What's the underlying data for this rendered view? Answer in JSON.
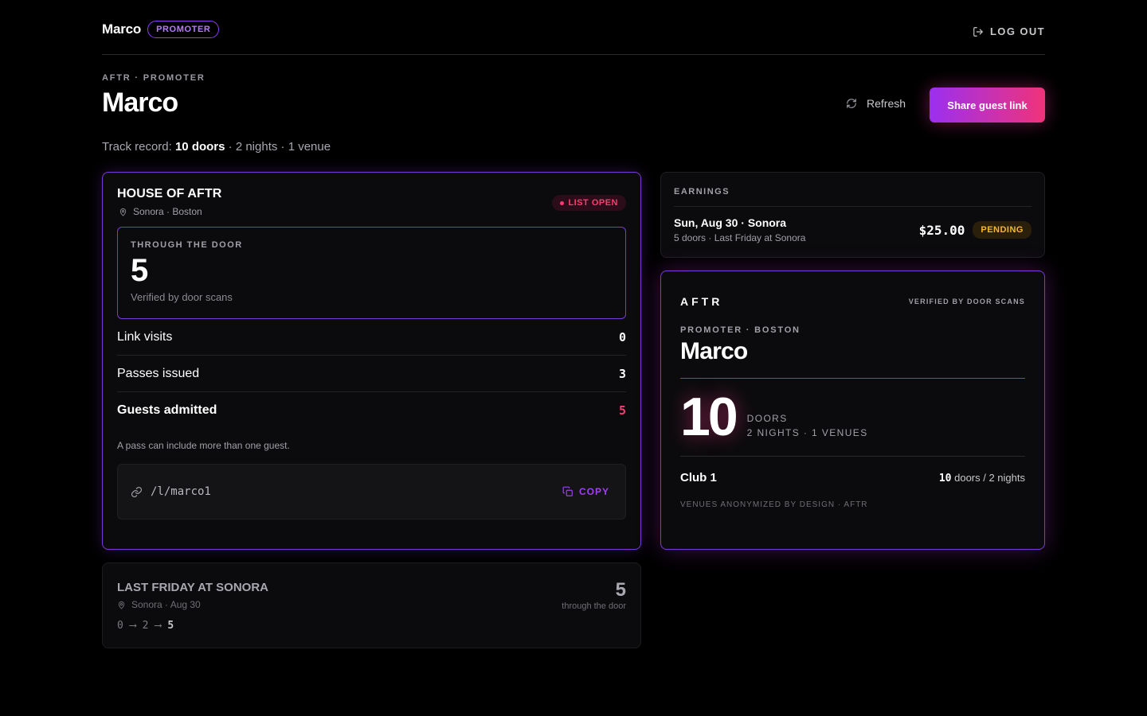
{
  "nav": {
    "user_name": "Marco",
    "role_badge": "PROMOTER",
    "logout_label": "LOG OUT"
  },
  "header": {
    "eyebrow": "AFTR · PROMOTER",
    "title": "Marco",
    "track_prefix": "Track record:",
    "track_doors": "10 doors",
    "track_rest": "· 2 nights · 1 venue",
    "refresh_label": "Refresh",
    "share_label": "Share guest link"
  },
  "event": {
    "title": "HOUSE OF AFTR",
    "location": "Sonora · Boston",
    "status": "LIST OPEN",
    "door_label": "THROUGH THE DOOR",
    "door_count": "5",
    "door_note": "Verified by door scans",
    "stats": [
      {
        "label": "Link visits",
        "value": "0"
      },
      {
        "label": "Passes issued",
        "value": "3"
      },
      {
        "label": "Guests admitted",
        "value": "5"
      }
    ],
    "pass_note": "A pass can include more than one guest.",
    "link": "/l/marco1",
    "copy_label": "COPY"
  },
  "past_event": {
    "title": "LAST FRIDAY AT SONORA",
    "sub": "Sonora · Aug 30",
    "flow": [
      "0",
      "2",
      "5"
    ],
    "count": "5",
    "count_label": "through the door"
  },
  "earnings": {
    "heading": "EARNINGS",
    "title": "Sun, Aug 30 · Sonora",
    "sub": "5 doors · Last Friday at Sonora",
    "amount": "$25.00",
    "status": "PENDING"
  },
  "profile": {
    "logo": "AFTR",
    "verified": "VERIFIED BY DOOR SCANS",
    "eyebrow": "PROMOTER · BOSTON",
    "name": "Marco",
    "big_number": "10",
    "big_label": "DOORS",
    "sub_label": "2 NIGHTS · 1 VENUES",
    "club_name": "Club 1",
    "club_doors": "10",
    "club_rest": "doors / 2 nights",
    "footer": "VENUES ANONYMIZED BY DESIGN · AFTR"
  },
  "colors": {
    "accent_purple": "#7a3ad8",
    "accent_pink": "#ff3b73",
    "pending": "#f5b82e"
  }
}
